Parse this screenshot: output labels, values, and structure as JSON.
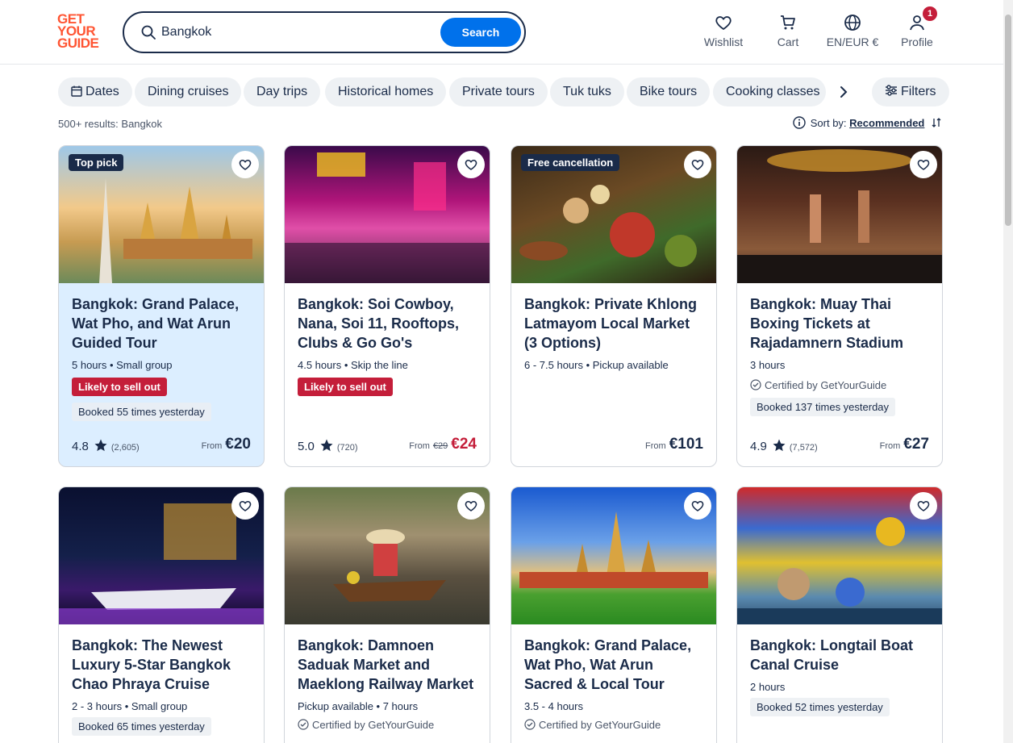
{
  "logo": {
    "line1": "GET",
    "line2": "YOUR",
    "line3": "GUIDE"
  },
  "search": {
    "value": "Bangkok",
    "button": "Search"
  },
  "nav": {
    "wishlist": "Wishlist",
    "cart": "Cart",
    "language": "EN/EUR €",
    "profile": "Profile",
    "profile_badge": "1"
  },
  "chips": [
    "Dates",
    "Dining cruises",
    "Day trips",
    "Historical homes",
    "Private tours",
    "Tuk tuks",
    "Bike tours",
    "Cooking classes"
  ],
  "filters_label": "Filters",
  "results": "500+ results: Bangkok",
  "sort": {
    "label": "Sort by:",
    "value": "Recommended"
  },
  "colors": {
    "accent": "#0071eb",
    "brand": "#ff5533",
    "sell_out": "#c41e3a",
    "navy": "#1a2b49"
  },
  "cards": [
    {
      "tag": "Top pick",
      "title": "Bangkok: Grand Palace, Wat Pho, and Wat Arun Guided Tour",
      "meta": "5 hours • Small group",
      "sell_out": "Likely to sell out",
      "booked": "Booked 55 times yesterday",
      "rating": "4.8",
      "reviews": "(2,605)",
      "from": "From",
      "price": "€20"
    },
    {
      "title": "Bangkok: Soi Cowboy, Nana, Soi 11, Rooftops, Clubs & Go Go's",
      "meta": "4.5 hours • Skip the line",
      "sell_out": "Likely to sell out",
      "rating": "5.0",
      "reviews": "(720)",
      "from": "From",
      "old_price": "€29",
      "price": "€24"
    },
    {
      "tag": "Free cancellation",
      "title": "Bangkok: Private Khlong Latmayom Local Market (3 Options)",
      "meta": "6 - 7.5 hours • Pickup available",
      "from": "From",
      "price": "€101"
    },
    {
      "title": "Bangkok: Muay Thai Boxing Tickets at Rajadamnern Stadium",
      "meta": "3 hours",
      "certified": "Certified by GetYourGuide",
      "booked": "Booked 137 times yesterday",
      "rating": "4.9",
      "reviews": "(7,572)",
      "from": "From",
      "price": "€27"
    },
    {
      "title": "Bangkok: The Newest Luxury 5-Star Bangkok Chao Phraya Cruise",
      "meta": "2 - 3 hours • Small group",
      "booked": "Booked 65 times yesterday"
    },
    {
      "title": "Bangkok: Damnoen Saduak Market and Maeklong Railway Market",
      "meta": "Pickup available • 7 hours",
      "certified": "Certified by GetYourGuide"
    },
    {
      "title": "Bangkok: Grand Palace, Wat Pho, Wat Arun Sacred & Local Tour",
      "meta": "3.5 - 4 hours",
      "certified": "Certified by GetYourGuide"
    },
    {
      "title": "Bangkok: Longtail Boat Canal Cruise",
      "meta": "2 hours",
      "booked": "Booked 52 times yesterday"
    }
  ]
}
